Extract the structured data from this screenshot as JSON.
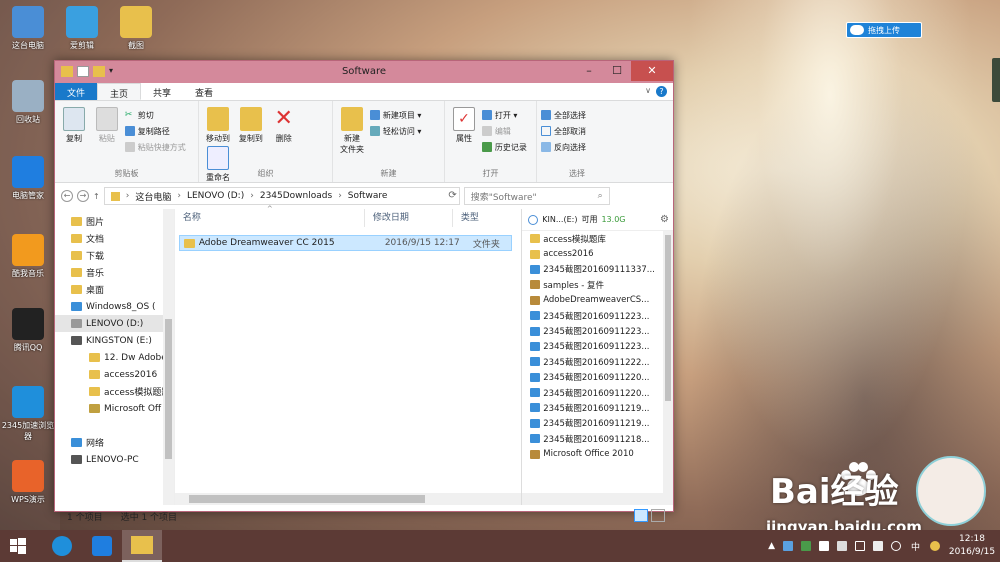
{
  "window": {
    "title": "Software"
  },
  "ribbon_tabs": [
    "文件",
    "主页",
    "共享",
    "查看"
  ],
  "ribbon": {
    "clipboard": {
      "name": "剪贴板",
      "copy": "复制",
      "paste": "粘贴",
      "cut": "剪切",
      "copy_path": "复制路径",
      "paste_shortcut": "粘贴快捷方式"
    },
    "organize": {
      "name": "组织",
      "move_to": "移动到",
      "copy_to": "复制到",
      "delete": "删除",
      "rename": "重命名"
    },
    "new": {
      "name": "新建",
      "new_folder_line1": "新建",
      "new_folder_line2": "文件夹",
      "new_item": "新建项目 ▾",
      "easy_access": "轻松访问 ▾"
    },
    "open": {
      "name": "打开",
      "properties": "属性",
      "open": "打开 ▾",
      "edit": "编辑",
      "history": "历史记录"
    },
    "select": {
      "name": "选择",
      "select_all": "全部选择",
      "select_none": "全部取消",
      "invert": "反向选择"
    }
  },
  "address": {
    "crumbs": [
      "这台电脑",
      "LENOVO (D:)",
      "2345Downloads",
      "Software"
    ],
    "search_placeholder": "搜索\"Software\""
  },
  "nav_items": [
    {
      "label": "图片",
      "level": 1,
      "color": "#e8c04c"
    },
    {
      "label": "文档",
      "level": 1,
      "color": "#e8c04c"
    },
    {
      "label": "下载",
      "level": 1,
      "color": "#e8c04c"
    },
    {
      "label": "音乐",
      "level": 1,
      "color": "#e8c04c"
    },
    {
      "label": "桌面",
      "level": 1,
      "color": "#e8c04c"
    },
    {
      "label": "Windows8_OS (",
      "level": 1,
      "color": "#3a8fd9"
    },
    {
      "label": "LENOVO (D:)",
      "level": 1,
      "color": "#999999",
      "selected": true
    },
    {
      "label": "KINGSTON (E:)",
      "level": 1,
      "color": "#555555"
    },
    {
      "label": "12. Dw Adobe",
      "level": 2,
      "color": "#e8c04c"
    },
    {
      "label": "access2016",
      "level": 2,
      "color": "#e8c04c"
    },
    {
      "label": "access模拟题题",
      "level": 2,
      "color": "#e8c04c"
    },
    {
      "label": "Microsoft Off",
      "level": 2,
      "color": "#c0a040"
    },
    {
      "label": "",
      "level": 0
    },
    {
      "label": "网络",
      "level": 1,
      "color": "#3a8fd9"
    },
    {
      "label": "LENOVO-PC",
      "level": 1,
      "color": "#555555"
    }
  ],
  "columns": {
    "name": "名称",
    "modified": "修改日期",
    "type": "类型"
  },
  "files": [
    {
      "name": "Adobe Dreamweaver CC 2015",
      "date": "2016/9/15 12:17",
      "type": "文件夹"
    }
  ],
  "preview": {
    "drive": "KIN...(E:)",
    "free_label": "可用",
    "free_value": "13.0G",
    "items": [
      {
        "name": "access模拟题库",
        "kind": "folder"
      },
      {
        "name": "access2016",
        "kind": "folder"
      },
      {
        "name": "2345截图201609111337...",
        "kind": "image"
      },
      {
        "name": "samples - 复件",
        "kind": "archive"
      },
      {
        "name": "AdobeDreamweaverCS...",
        "kind": "archive"
      },
      {
        "name": "2345截图20160911223...",
        "kind": "image"
      },
      {
        "name": "2345截图20160911223...",
        "kind": "image"
      },
      {
        "name": "2345截图20160911223...",
        "kind": "image"
      },
      {
        "name": "2345截图20160911222...",
        "kind": "image"
      },
      {
        "name": "2345截图20160911220...",
        "kind": "image"
      },
      {
        "name": "2345截图20160911220...",
        "kind": "image"
      },
      {
        "name": "2345截图20160911219...",
        "kind": "image"
      },
      {
        "name": "2345截图20160911219...",
        "kind": "image"
      },
      {
        "name": "2345截图20160911218...",
        "kind": "image"
      },
      {
        "name": "Microsoft Office 2010",
        "kind": "archive"
      }
    ]
  },
  "status": {
    "count": "1 个项目",
    "selected": "选中 1 个项目"
  },
  "desktop_icons": [
    {
      "label": "这台电脑",
      "icon": "computer-icon",
      "color": "#4a8ed6"
    },
    {
      "label": "爱剪辑",
      "icon": "video-editor-icon",
      "color": "#3aa0e0"
    },
    {
      "label": "截图",
      "icon": "folder-icon",
      "color": "#e8c04c"
    },
    {
      "label": "回收站",
      "icon": "recycle-bin-icon",
      "color": "#9ab0c4"
    },
    {
      "label": "电脑管家",
      "icon": "shield-icon",
      "color": "#1f7ee0"
    },
    {
      "label": "酷我音乐",
      "icon": "music-icon",
      "color": "#f29a1e"
    },
    {
      "label": "腾讯QQ",
      "icon": "penguin-icon",
      "color": "#222222"
    },
    {
      "label": "2345加速浏览器",
      "icon": "browser-icon",
      "color": "#1f8fdb"
    },
    {
      "label": "WPS演示",
      "icon": "presentation-icon",
      "color": "#e8632a"
    }
  ],
  "upload_button": "拖拽上传",
  "watermark": {
    "brand": "Bai经验",
    "url": "jingyan.baidu.com"
  },
  "taskbar": {
    "tray_ime": "中",
    "time": "12:18",
    "date": "2016/9/15"
  }
}
